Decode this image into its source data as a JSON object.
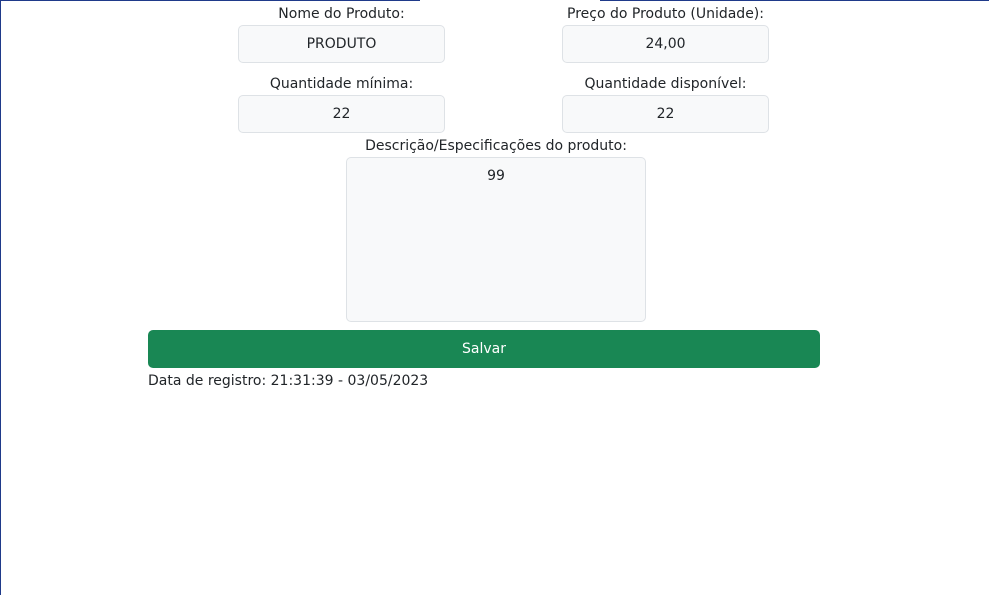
{
  "form": {
    "product_name": {
      "label": "Nome do Produto:",
      "value": "PRODUTO"
    },
    "unit_price": {
      "label": "Preço do Produto (Unidade):",
      "value": "24,00"
    },
    "min_quantity": {
      "label": "Quantidade mínima:",
      "value": "22"
    },
    "available_quantity": {
      "label": "Quantidade disponível:",
      "value": "22"
    },
    "description": {
      "label": "Descrição/Especificações do produto:",
      "value": "99"
    },
    "save_label": "Salvar",
    "registration": {
      "label": "Data de registro:",
      "time": "21:31:39",
      "separator": "-",
      "date": "03/05/2023"
    }
  },
  "colors": {
    "save_button": "#198754",
    "input_background": "#f8f9fa",
    "input_border": "#dee2e6",
    "window_frame": "#1f3a8a"
  }
}
